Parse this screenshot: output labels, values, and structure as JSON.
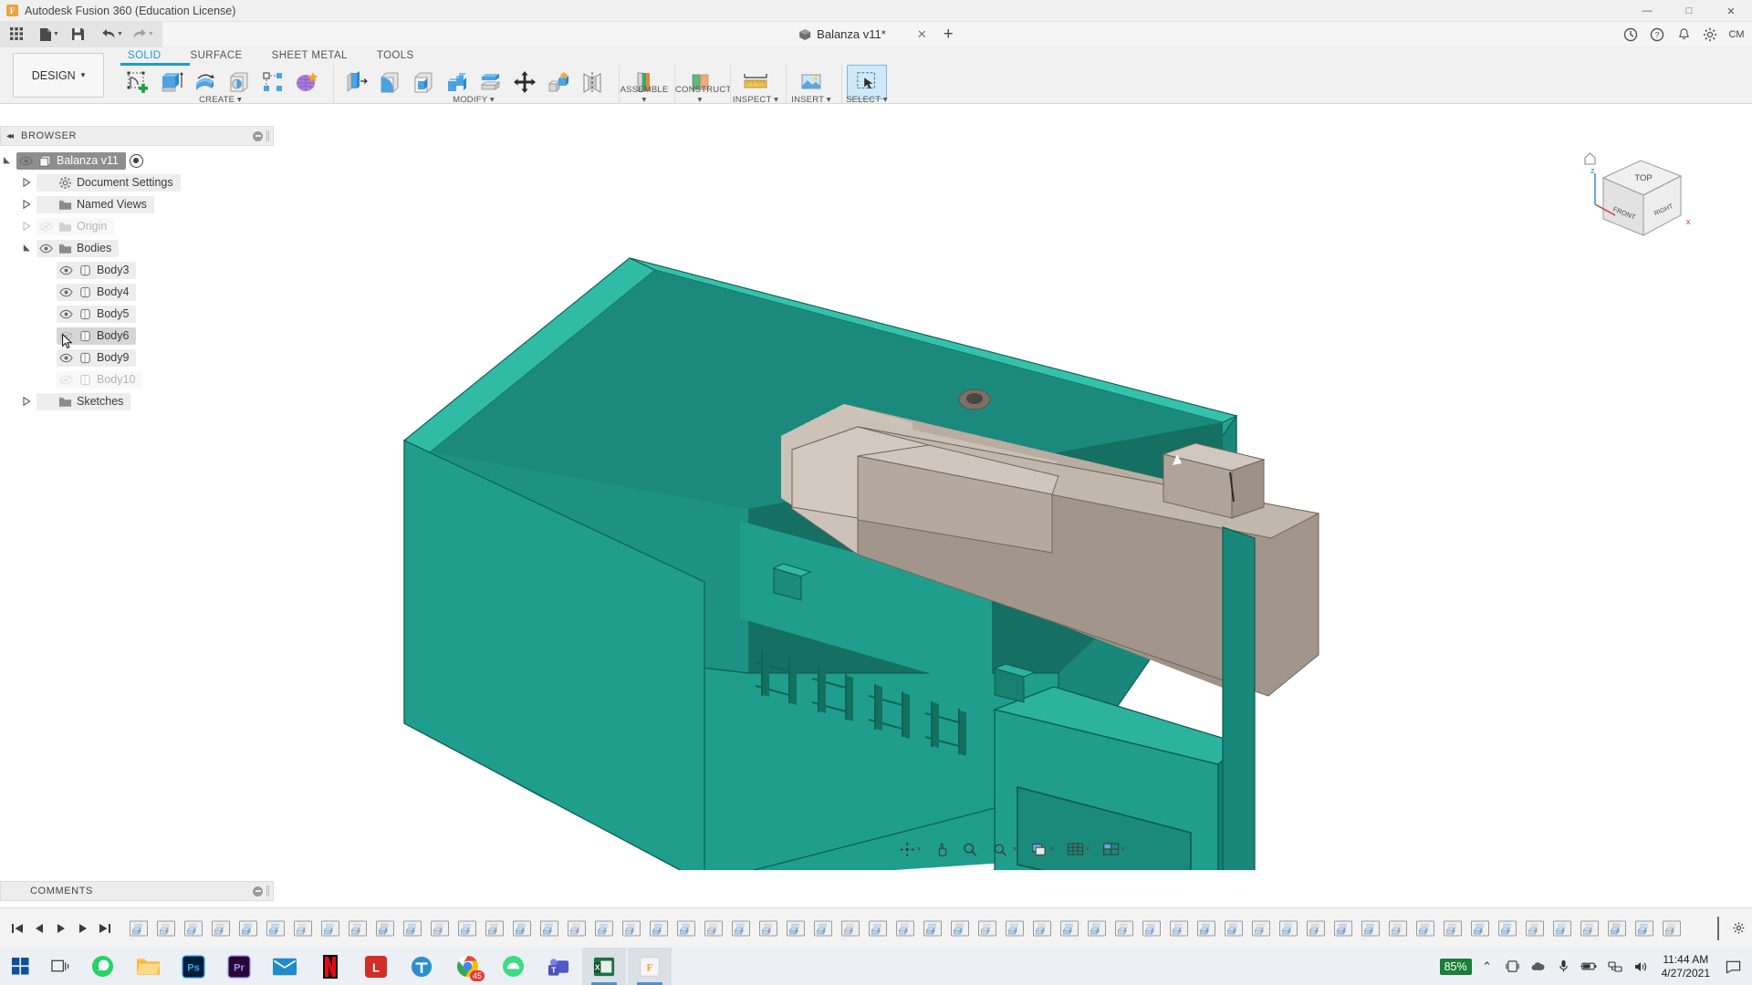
{
  "titlebar": {
    "app_title": "Autodesk Fusion 360 (Education License)",
    "logo_letter": "F",
    "minimize": "—",
    "maximize": "□",
    "close": "✕"
  },
  "quick_access": {
    "grid_icon": "app-grid-icon",
    "new_icon": "new-document-icon",
    "save_icon": "save-icon",
    "undo_icon": "undo-icon",
    "redo_icon": "redo-icon",
    "document_name": "Balanza v11*",
    "document_close": "✕",
    "add_tab": "+",
    "help_icon": "help-icon",
    "job_status_icon": "job-status-icon",
    "notifications_icon": "bell-icon",
    "settings_icon": "gear-icon",
    "user_initials": "CM"
  },
  "ribbon": {
    "workspace_label": "DESIGN",
    "workspace_caret": "▾",
    "tabs": [
      {
        "label": "SOLID",
        "active": true
      },
      {
        "label": "SURFACE",
        "active": false
      },
      {
        "label": "SHEET METAL",
        "active": false
      },
      {
        "label": "TOOLS",
        "active": false
      }
    ],
    "panels": [
      {
        "label": "CREATE ▾",
        "id": "create"
      },
      {
        "label": "MODIFY ▾",
        "id": "modify"
      },
      {
        "label": "ASSEMBLE ▾",
        "id": "assemble"
      },
      {
        "label": "CONSTRUCT ▾",
        "id": "construct"
      },
      {
        "label": "INSPECT ▾",
        "id": "inspect"
      },
      {
        "label": "INSERT ▾",
        "id": "insert"
      },
      {
        "label": "SELECT ▾",
        "id": "select"
      }
    ]
  },
  "browser": {
    "header": "BROWSER",
    "collapse_icon": "◂◂",
    "nodes": [
      {
        "label": "Balanza v11",
        "depth": 0,
        "twisty": "open",
        "eye": "visible",
        "icon": "component-icon",
        "selected": true,
        "radio": true
      },
      {
        "label": "Document Settings",
        "depth": 1,
        "twisty": "closed",
        "eye": "none",
        "icon": "gear-icon",
        "selected": false,
        "radio": false
      },
      {
        "label": "Named Views",
        "depth": 1,
        "twisty": "closed",
        "eye": "none",
        "icon": "folder-icon",
        "selected": false,
        "radio": false
      },
      {
        "label": "Origin",
        "depth": 1,
        "twisty": "closed",
        "eye": "hidden",
        "icon": "folder-icon",
        "selected": false,
        "radio": false,
        "dim": true
      },
      {
        "label": "Bodies",
        "depth": 1,
        "twisty": "open",
        "eye": "visible",
        "icon": "folder-icon",
        "selected": false,
        "radio": false
      },
      {
        "label": "Body3",
        "depth": 2,
        "twisty": "none",
        "eye": "visible",
        "icon": "body-icon",
        "selected": false,
        "radio": false
      },
      {
        "label": "Body4",
        "depth": 2,
        "twisty": "none",
        "eye": "visible",
        "icon": "body-icon",
        "selected": false,
        "radio": false
      },
      {
        "label": "Body5",
        "depth": 2,
        "twisty": "none",
        "eye": "visible",
        "icon": "body-icon",
        "selected": false,
        "radio": false
      },
      {
        "label": "Body6",
        "depth": 2,
        "twisty": "none",
        "eye": "hidden",
        "icon": "body-icon",
        "selected": false,
        "radio": false,
        "hover": true,
        "cursor": true
      },
      {
        "label": "Body9",
        "depth": 2,
        "twisty": "none",
        "eye": "visible",
        "icon": "body-icon",
        "selected": false,
        "radio": false
      },
      {
        "label": "Body10",
        "depth": 2,
        "twisty": "none",
        "eye": "hidden",
        "icon": "body-icon",
        "selected": false,
        "radio": false,
        "dim": true
      },
      {
        "label": "Sketches",
        "depth": 1,
        "twisty": "closed",
        "eye": "none",
        "icon": "folder-icon",
        "selected": false,
        "radio": false
      }
    ]
  },
  "comments": {
    "header": "COMMENTS"
  },
  "viewcube": {
    "top_face": "TOP",
    "front_face": "FRONT",
    "right_face": "RIGHT",
    "axis_z": "z",
    "axis_x": "x",
    "home_icon": "home-icon"
  },
  "navbar": {
    "items": [
      {
        "name": "orbit-icon",
        "caret": true
      },
      {
        "name": "pan-icon",
        "caret": false
      },
      {
        "name": "zoom-icon",
        "caret": false
      },
      {
        "name": "zoom-window-icon",
        "caret": false
      },
      {
        "name": "fit-icon",
        "caret": true
      },
      {
        "name": "display-settings-icon",
        "caret": true
      },
      {
        "name": "grid-snaps-icon",
        "caret": true
      },
      {
        "name": "viewports-icon",
        "caret": true
      }
    ]
  },
  "timeline": {
    "playback": [
      "jump-start-icon",
      "step-back-icon",
      "play-icon",
      "step-forward-icon",
      "jump-end-icon"
    ],
    "feature_count": 57,
    "end_marker": "timeline-end-marker"
  },
  "taskbar": {
    "start_icon": "windows-start-icon",
    "search_icon": "task-view-icon",
    "apps": [
      {
        "name": "whatsapp",
        "color": "#25d366",
        "active": false
      },
      {
        "name": "file-explorer",
        "color": "#f7b500",
        "active": false
      },
      {
        "name": "photoshop",
        "color": "#001e36",
        "label": "Ps",
        "active": false
      },
      {
        "name": "premiere-pro",
        "color": "#2a0634",
        "label": "Pr",
        "active": false
      },
      {
        "name": "mail",
        "color": "#1e8bcd",
        "active": false
      },
      {
        "name": "netflix",
        "color": "#e50914",
        "label": "N",
        "active": false
      },
      {
        "name": "lastpass",
        "color": "#d32d27",
        "label": "L",
        "active": false
      },
      {
        "name": "thingiverse",
        "color": "#2d8fc9",
        "active": false
      },
      {
        "name": "chrome",
        "color": "#4285f4",
        "badge": "45",
        "active": false
      },
      {
        "name": "android-studio",
        "color": "#3ddc84",
        "active": false
      },
      {
        "name": "microsoft-teams",
        "color": "#5059c9",
        "active": false
      },
      {
        "name": "excel",
        "color": "#1d6f42",
        "active": true
      },
      {
        "name": "fusion-360",
        "color": "#e8a33d",
        "label": "F",
        "active": true
      }
    ],
    "tray": {
      "battery_percent": "85%",
      "chevron_up": "⌃",
      "icons": [
        "screen-cast-icon",
        "onedrive-icon",
        "microphone-icon",
        "battery-icon",
        "network-icon",
        "volume-icon"
      ],
      "time": "11:44 AM",
      "date": "4/27/2021",
      "action_center": "notification-icon"
    }
  },
  "colors": {
    "accent_blue": "#1a9ad7",
    "model_teal": "#1f9e8d",
    "model_teal_dark": "#167a6c",
    "model_gray": "#a89d94",
    "taskbar_bg": "#eceff3",
    "battery_green": "#1a7f37"
  }
}
